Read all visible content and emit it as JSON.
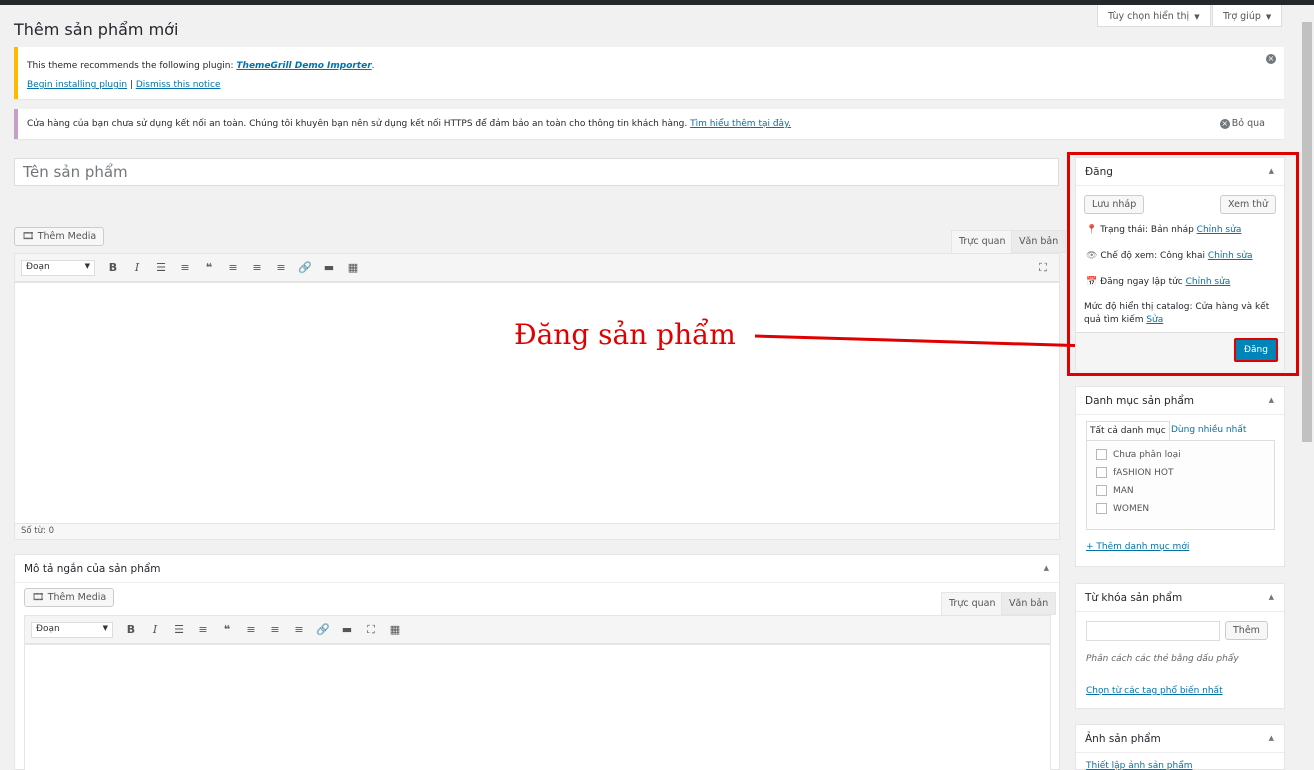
{
  "screen_options": {
    "display_label": "Tùy chọn hiển thị",
    "help_label": "Trợ giúp"
  },
  "page_title": "Thêm sản phẩm mới",
  "notice_plugin": {
    "text": "This theme recommends the following plugin: ",
    "plugin_name": "ThemeGrill Demo Importer",
    "period": ".",
    "begin_link": "Begin installing plugin",
    "separator": "|",
    "dismiss_link": "Dismiss this notice"
  },
  "notice_https": {
    "text": "Cửa hàng của bạn chưa sử dụng kết nối an toàn. Chúng tôi khuyên bạn nên sử dụng kết nối HTTPS để đảm bảo an toàn cho thông tin khách hàng. ",
    "link": "Tìm hiểu thêm tại đây.",
    "dismiss": "Bỏ qua"
  },
  "title_input": {
    "placeholder": "Tên sản phẩm"
  },
  "editor": {
    "add_media": "Thêm Media",
    "tab_visual": "Trực quan",
    "tab_text": "Văn bản",
    "format_select": "Đoạn",
    "word_count": "Số từ: 0"
  },
  "annotation": {
    "text": "Đăng sản phẩm",
    "color": "#e00000"
  },
  "publish_box": {
    "title": "Đăng",
    "save_draft": "Lưu nháp",
    "preview": "Xem thử",
    "status_label": "Trạng thái: ",
    "status_value": "Bản nháp",
    "visibility_label": "Chế độ xem: ",
    "visibility_value": "Công khai",
    "schedule_label": "Đăng ngay lập tức",
    "edit_link": "Chỉnh sửa",
    "catalog_label": "Mức độ hiển thị catalog: ",
    "catalog_value": "Cửa hàng và kết quả tìm kiếm",
    "catalog_edit": "Sửa",
    "publish_button": "Đăng",
    "accent_color": "#0085ba"
  },
  "categories_box": {
    "title": "Danh mục sản phẩm",
    "tab_all": "Tất cả danh mục",
    "tab_popular": "Dùng nhiều nhất",
    "items": [
      "Chưa phân loại",
      "fASHION HOT",
      "MAN",
      "WOMEN"
    ],
    "add_link": "+ Thêm danh mục mới"
  },
  "short_desc_box": {
    "title": "Mô tả ngắn của sản phẩm"
  },
  "tags_box": {
    "title": "Từ khóa sản phẩm",
    "add_button": "Thêm",
    "hint": "Phân cách các thẻ bằng dấu phẩy",
    "popular_link": "Chọn từ các tag phổ biến nhất"
  },
  "image_box": {
    "title": "Ảnh sản phẩm",
    "set_link": "Thiết lập ảnh sản phẩm"
  }
}
